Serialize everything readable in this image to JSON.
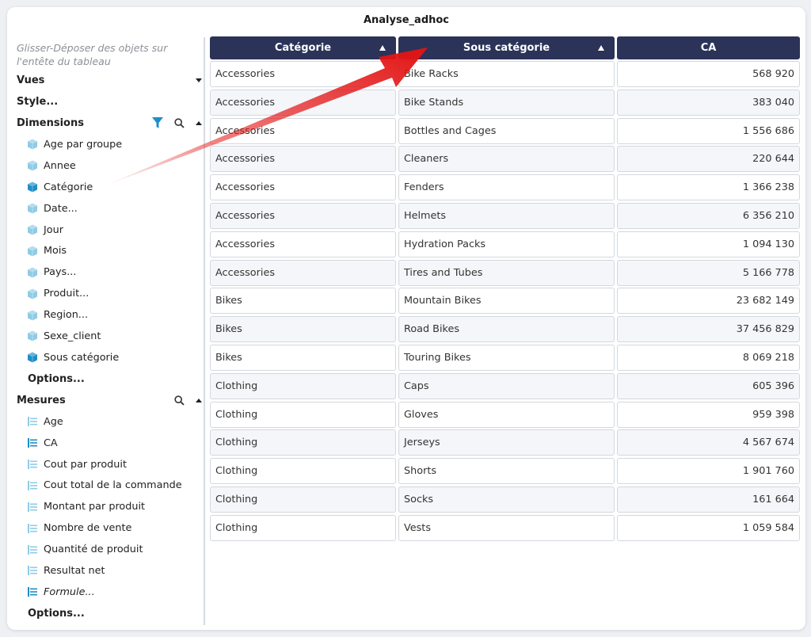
{
  "window": {
    "title": "Analyse_adhoc"
  },
  "sidebar": {
    "hint": "Glisser-Déposer des objets sur l'entête du tableau",
    "vues_label": "Vues",
    "style_label": "Style...",
    "dimensions_label": "Dimensions",
    "dimensions": [
      {
        "label": "Age par groupe",
        "active": false
      },
      {
        "label": "Annee",
        "active": false
      },
      {
        "label": "Catégorie",
        "active": true
      },
      {
        "label": "Date...",
        "active": false
      },
      {
        "label": "Jour",
        "active": false
      },
      {
        "label": "Mois",
        "active": false
      },
      {
        "label": "Pays...",
        "active": false
      },
      {
        "label": "Produit...",
        "active": false
      },
      {
        "label": "Region...",
        "active": false
      },
      {
        "label": "Sexe_client",
        "active": false
      },
      {
        "label": "Sous catégorie",
        "active": true
      }
    ],
    "dimensions_options": "Options...",
    "mesures_label": "Mesures",
    "mesures": [
      {
        "label": "Age",
        "active": false
      },
      {
        "label": "CA",
        "active": true
      },
      {
        "label": "Cout par produit",
        "active": false
      },
      {
        "label": "Cout total de la commande",
        "active": false
      },
      {
        "label": "Montant par produit",
        "active": false
      },
      {
        "label": "Nombre de vente",
        "active": false
      },
      {
        "label": "Quantité de produit",
        "active": false
      },
      {
        "label": "Resultat net",
        "active": false
      },
      {
        "label": "Formule...",
        "active": true
      }
    ],
    "mesures_options": "Options..."
  },
  "table": {
    "headers": [
      "Catégorie",
      "Sous catégorie",
      "CA"
    ],
    "rows": [
      [
        "Accessories",
        "Bike Racks",
        "568 920"
      ],
      [
        "Accessories",
        "Bike Stands",
        "383 040"
      ],
      [
        "Accessories",
        "Bottles and Cages",
        "1 556 686"
      ],
      [
        "Accessories",
        "Cleaners",
        "220 644"
      ],
      [
        "Accessories",
        "Fenders",
        "1 366 238"
      ],
      [
        "Accessories",
        "Helmets",
        "6 356 210"
      ],
      [
        "Accessories",
        "Hydration Packs",
        "1 094 130"
      ],
      [
        "Accessories",
        "Tires and Tubes",
        "5 166 778"
      ],
      [
        "Bikes",
        "Mountain Bikes",
        "23 682 149"
      ],
      [
        "Bikes",
        "Road Bikes",
        "37 456 829"
      ],
      [
        "Bikes",
        "Touring Bikes",
        "8 069 218"
      ],
      [
        "Clothing",
        "Caps",
        "605 396"
      ],
      [
        "Clothing",
        "Gloves",
        "959 398"
      ],
      [
        "Clothing",
        "Jerseys",
        "4 567 674"
      ],
      [
        "Clothing",
        "Shorts",
        "1 901 760"
      ],
      [
        "Clothing",
        "Socks",
        "161 664"
      ],
      [
        "Clothing",
        "Vests",
        "1 059 584"
      ]
    ]
  },
  "colors": {
    "header_bg": "#2b3358",
    "cube_light": "#8fcbe6",
    "cube_active": "#1e8ec6",
    "arrow": "#e31414"
  },
  "icons": {
    "filter": "filter-icon",
    "search": "search-icon",
    "dimension": "cube-icon",
    "measure": "measure-icon"
  }
}
